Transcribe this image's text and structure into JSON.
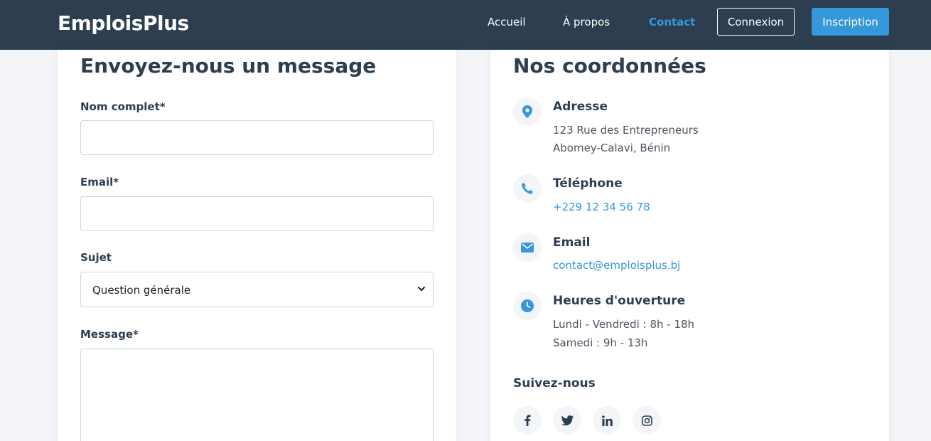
{
  "navbar": {
    "logo": "EmploisPlus",
    "links": [
      "Accueil",
      "À propos",
      "Contact"
    ],
    "login": "Connexion",
    "signup": "Inscription"
  },
  "form": {
    "title": "Envoyez-nous un message",
    "name_label": "Nom complet*",
    "email_label": "Email*",
    "subject_label": "Sujet",
    "subject_value": "Question générale",
    "message_label": "Message*"
  },
  "info": {
    "title": "Nos coordonnées",
    "address_title": "Adresse",
    "address_line1": "123 Rue des Entrepreneurs",
    "address_line2": "Abomey-Calavi, Bénin",
    "phone_title": "Téléphone",
    "phone": "+229 12 34 56 78",
    "email_title": "Email",
    "email": "contact@emploisplus.bj",
    "hours_title": "Heures d'ouverture",
    "hours_line1": "Lundi - Vendredi : 8h - 18h",
    "hours_line2": "Samedi : 9h - 13h",
    "follow_title": "Suivez-nous",
    "socials": [
      "facebook-icon",
      "twitter-icon",
      "linkedin-icon",
      "instagram-icon"
    ]
  },
  "colors": {
    "navbar": "#2c3e50",
    "accent": "#3498db",
    "background": "#f3f5f9"
  }
}
